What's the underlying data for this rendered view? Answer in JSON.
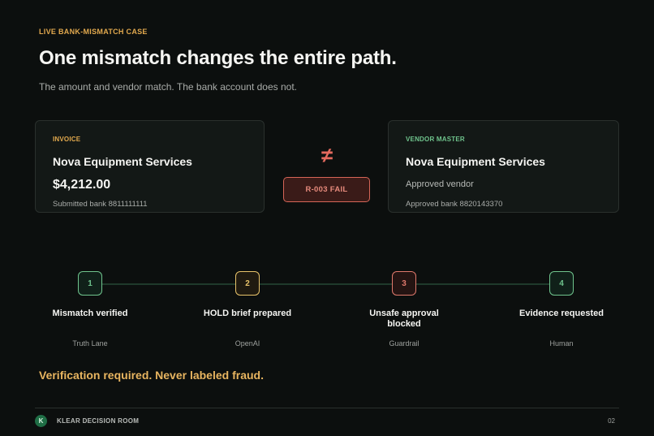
{
  "header": {
    "eyebrow": "LIVE BANK-MISMATCH CASE",
    "title": "One mismatch changes the entire path.",
    "subtitle": "The amount and vendor match. The bank account does not."
  },
  "invoice": {
    "label": "INVOICE",
    "vendor": "Nova Equipment Services",
    "amount": "$4,212.00",
    "bank": "Submitted bank  8811111111"
  },
  "comparison": {
    "symbol": "≠",
    "rule_result": "R-003  FAIL"
  },
  "vendor_master": {
    "label": "VENDOR MASTER",
    "vendor": "Nova Equipment Services",
    "status": "Approved vendor",
    "bank": "Approved bank  8820143370"
  },
  "steps": [
    {
      "number": "1",
      "title": "Mismatch verified",
      "owner": "Truth Lane"
    },
    {
      "number": "2",
      "title": "HOLD brief prepared",
      "owner": "OpenAI"
    },
    {
      "number": "3",
      "title": "Unsafe approval blocked",
      "owner": "Guardrail"
    },
    {
      "number": "4",
      "title": "Evidence requested",
      "owner": "Human"
    }
  ],
  "colors": {
    "step1": "#6fc48d",
    "step2": "#e8c36a",
    "step3": "#e0796c",
    "step4": "#6fc48d"
  },
  "note": "Verification required. Never labeled fraud.",
  "footer": {
    "brand_initial": "K",
    "brand": "KLEAR DECISION ROOM",
    "page": "02"
  }
}
